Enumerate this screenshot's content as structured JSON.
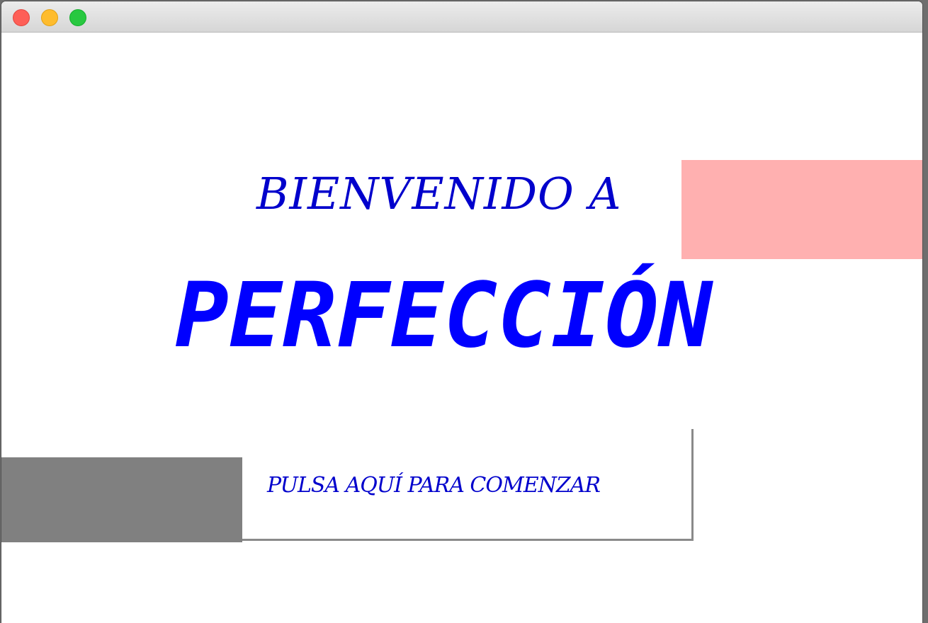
{
  "window": {
    "background": "#ffffff"
  },
  "screen": {
    "welcome_text": "BIENVENIDO A",
    "app_title": "PERFECCIÓN",
    "start_button_label": "PULSA AQUÍ PARA COMENZAR"
  },
  "colors": {
    "welcome_text": "#0000cc",
    "app_title": "#0000ff",
    "button_text": "#0000cc",
    "pink_block": "#ffb0b0",
    "gray_block": "#808080"
  },
  "icons": {
    "close": "close-icon",
    "minimize": "minimize-icon",
    "zoom": "zoom-icon"
  }
}
